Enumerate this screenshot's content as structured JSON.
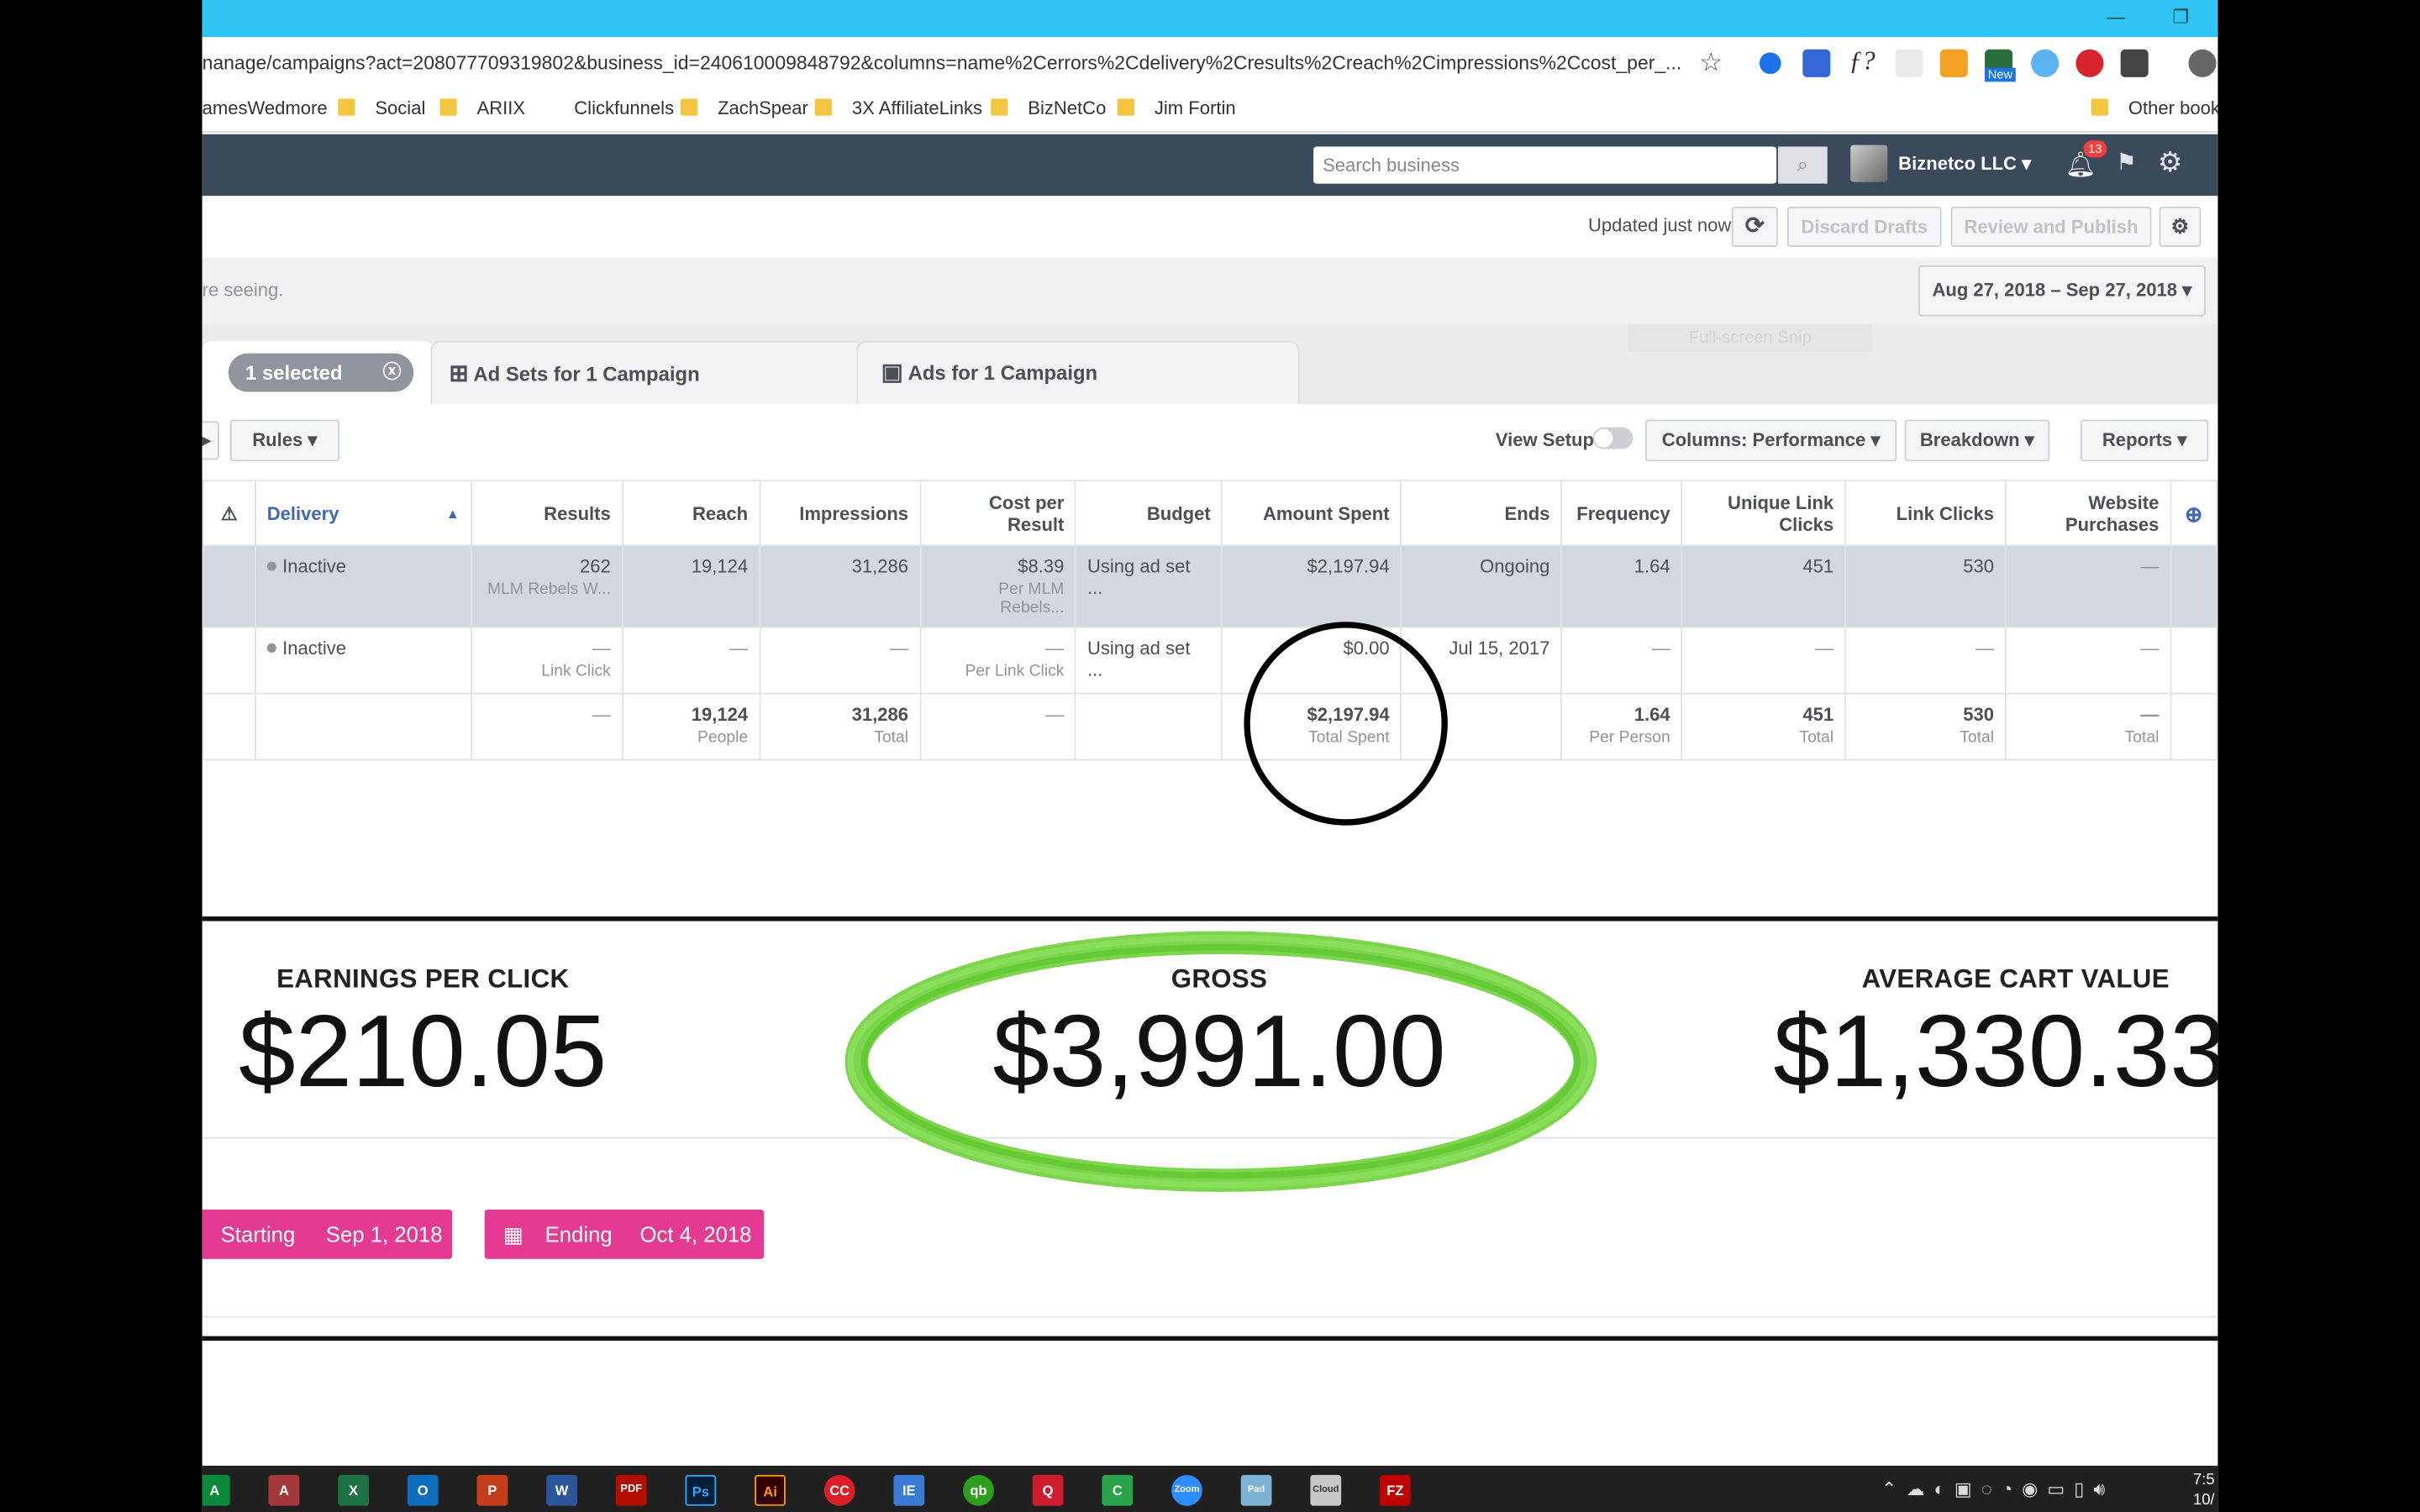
{
  "browser": {
    "url": "nanage/campaigns?act=208077709319802&business_id=240610009848792&columns=name%2Cerrors%2Cdelivery%2Cresults%2Creach%2Cimpressions%2Ccost_per_...",
    "bookmarks": [
      "amesWedmore",
      "Social",
      "ARIIX",
      "Clickfunnels",
      "ZachSpear",
      "3X AffiliateLinks",
      "BizNetCo",
      "Jim Fortin"
    ],
    "other_bookmarks": "Other book",
    "ext_badge": "New"
  },
  "fb_header": {
    "search_placeholder": "Search business",
    "business_name": "Biznetco LLC",
    "notification_count": "13"
  },
  "toolbar": {
    "updated_text": "Updated just now",
    "discard_label": "Discard Drafts",
    "review_label": "Review and Publish"
  },
  "info": {
    "partial_text": "re seeing.",
    "date_range": "Aug 27, 2018 – Sep 27, 2018",
    "ghost_text": "Full-screen Snip"
  },
  "tabs": {
    "selected": "1 selected",
    "adsets": "Ad Sets for 1 Campaign",
    "ads": "Ads for 1 Campaign"
  },
  "filters": {
    "rules": "Rules",
    "view_setup": "View Setup",
    "columns": "Columns: Performance",
    "breakdown": "Breakdown",
    "reports": "Reports"
  },
  "table": {
    "headers": {
      "delivery": "Delivery",
      "results": "Results",
      "reach": "Reach",
      "impressions": "Impressions",
      "cpr": "Cost per Result",
      "budget": "Budget",
      "amount": "Amount Spent",
      "ends": "Ends",
      "frequency": "Frequency",
      "unique_link_clicks": "Unique Link Clicks",
      "link_clicks": "Link Clicks",
      "purchases": "Website Purchases"
    },
    "rows": [
      {
        "delivery": "Inactive",
        "results": "262",
        "results_sub": "MLM Rebels W...",
        "reach": "19,124",
        "impressions": "31,286",
        "cpr": "$8.39",
        "cpr_sub": "Per MLM Rebels...",
        "budget": "Using ad set ...",
        "amount": "$2,197.94",
        "ends": "Ongoing",
        "frequency": "1.64",
        "unique": "451",
        "clicks": "530",
        "purchases": "—"
      },
      {
        "delivery": "Inactive",
        "results": "—",
        "results_sub": "Link Click",
        "reach": "—",
        "impressions": "—",
        "cpr": "—",
        "cpr_sub": "Per Link Click",
        "budget": "Using ad set ...",
        "amount": "$0.00",
        "ends": "Jul 15, 2017",
        "frequency": "—",
        "unique": "—",
        "clicks": "—",
        "purchases": "—"
      }
    ],
    "totals": {
      "results": "—",
      "reach": "19,124",
      "reach_sub": "People",
      "impressions": "31,286",
      "impressions_sub": "Total",
      "cpr": "—",
      "amount": "$2,197.94",
      "amount_sub": "Total Spent",
      "frequency": "1.64",
      "frequency_sub": "Per Person",
      "unique": "451",
      "unique_sub": "Total",
      "clicks": "530",
      "clicks_sub": "Total",
      "purchases": "—",
      "purchases_sub": "Total"
    }
  },
  "stats": {
    "epc_label": "EARNINGS PER CLICK",
    "epc_value": "$210.05",
    "gross_label": "GROSS",
    "gross_value": "$3,991.00",
    "acv_label": "AVERAGE CART VALUE",
    "acv_value": "$1,330.33"
  },
  "dates": {
    "start_label": "Starting",
    "start_value": "Sep 1, 2018",
    "end_label": "Ending",
    "end_value": "Oct 4, 2018"
  },
  "taskbar": {
    "apps": [
      "A",
      "X",
      "O",
      "P",
      "W",
      "PDF",
      "Ps",
      "Ai",
      "CC",
      "IE",
      "qb",
      "Q",
      "C",
      "Zoom",
      "Pad",
      "Cloud",
      "FZ"
    ],
    "time": "7:5",
    "date": "10/"
  },
  "colors": {
    "chrome_titlebar": "#2ec5f2",
    "fb_header": "#3b4a5a",
    "pill_pink": "#e43a92",
    "green_circle": "#6fd03b"
  }
}
